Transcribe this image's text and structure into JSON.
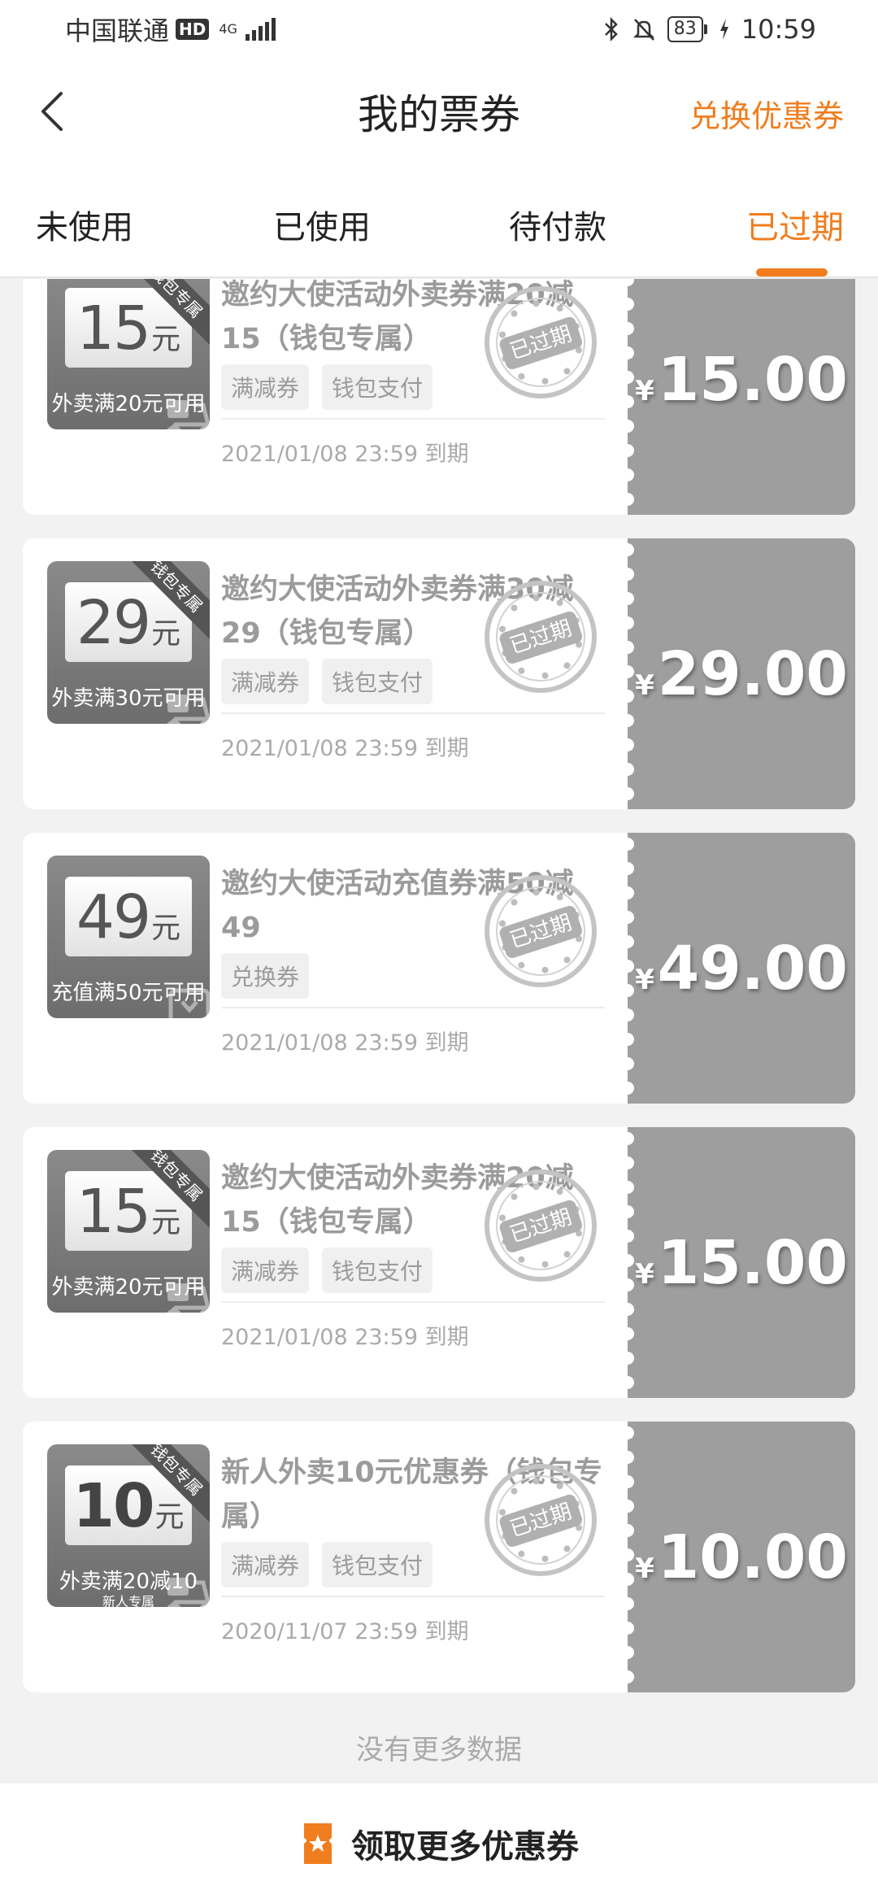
{
  "status_bar": {
    "carrier": "中国联通",
    "hd": "HD",
    "network": "4G",
    "battery": "83",
    "time": "10:59"
  },
  "header": {
    "title": "我的票券",
    "exchange_label": "兑换优惠券"
  },
  "tabs": [
    {
      "label": "未使用",
      "active": false
    },
    {
      "label": "已使用",
      "active": false
    },
    {
      "label": "待付款",
      "active": false
    },
    {
      "label": "已过期",
      "active": true
    }
  ],
  "coupons": [
    {
      "title": "邀约大使活动外卖券满20减15（钱包专属）",
      "tags": [
        "满减券",
        "钱包支付"
      ],
      "expire": "2021/01/08 23:59 到期",
      "thumb_value": "15",
      "thumb_unit": "元",
      "thumb_condition": "外卖满20元可用",
      "ribbon": "钱包专属",
      "stamp": "已过期",
      "currency": "¥",
      "price": "15.00"
    },
    {
      "title": "邀约大使活动外卖券满30减29（钱包专属）",
      "tags": [
        "满减券",
        "钱包支付"
      ],
      "expire": "2021/01/08 23:59 到期",
      "thumb_value": "29",
      "thumb_unit": "元",
      "thumb_condition": "外卖满30元可用",
      "ribbon": "钱包专属",
      "stamp": "已过期",
      "currency": "¥",
      "price": "29.00"
    },
    {
      "title": "邀约大使活动充值券满50减49",
      "tags": [
        "兑换券"
      ],
      "expire": "2021/01/08 23:59 到期",
      "thumb_value": "49",
      "thumb_unit": "元",
      "thumb_condition": "充值满50元可用",
      "ribbon": "",
      "stamp": "已过期",
      "currency": "¥",
      "price": "49.00"
    },
    {
      "title": "邀约大使活动外卖券满20减15（钱包专属）",
      "tags": [
        "满减券",
        "钱包支付"
      ],
      "expire": "2021/01/08 23:59 到期",
      "thumb_value": "15",
      "thumb_unit": "元",
      "thumb_condition": "外卖满20元可用",
      "ribbon": "钱包专属",
      "stamp": "已过期",
      "currency": "¥",
      "price": "15.00"
    },
    {
      "title": "新人外卖10元优惠券（钱包专属）",
      "tags": [
        "满减券",
        "钱包支付"
      ],
      "expire": "2020/11/07 23:59 到期",
      "thumb_value": "10",
      "thumb_unit": "元",
      "thumb_condition": "外卖满20减10",
      "thumb_sub": "新人专属",
      "ribbon": "钱包专属",
      "stamp": "已过期",
      "currency": "¥",
      "price": "10.00"
    }
  ],
  "no_more": "没有更多数据",
  "bottom": {
    "label": "领取更多优惠券"
  },
  "colors": {
    "accent": "#f07d1e",
    "expired_gray": "#9e9e9e"
  },
  "icons": [
    "back-arrow-icon",
    "bluetooth-icon",
    "mute-bell-icon",
    "charging-icon",
    "coupon-ticket-icon",
    "expired-stamp-icon",
    "scooter-icon",
    "recharge-box-icon"
  ]
}
